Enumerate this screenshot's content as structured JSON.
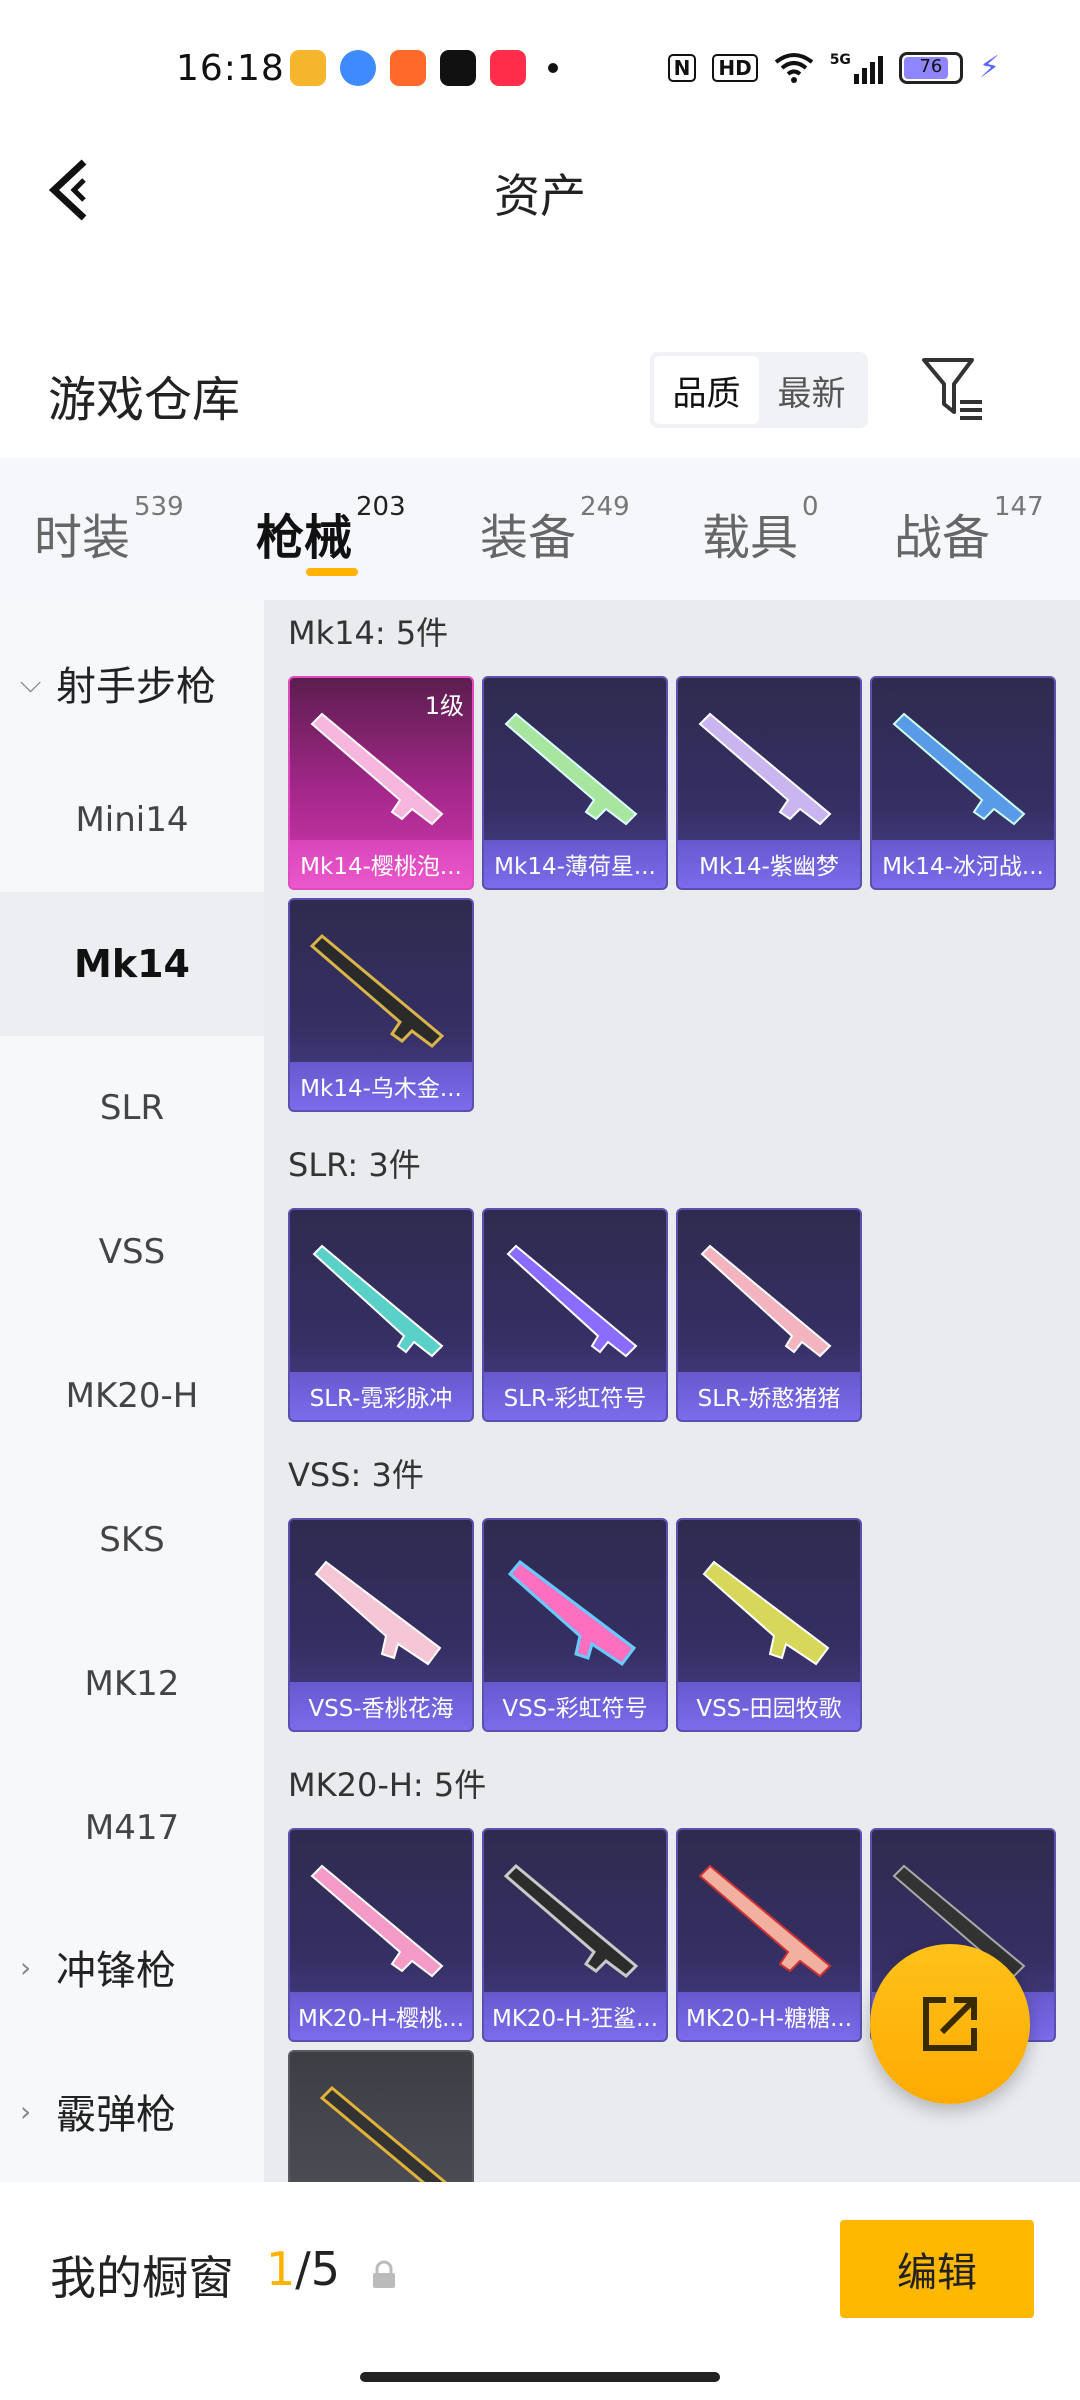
{
  "status": {
    "time": "16:18",
    "battery": "76",
    "hd": "HD",
    "net": "5G"
  },
  "header": {
    "title": "资产"
  },
  "section": {
    "title": "游戏仓库",
    "sort_quality": "品质",
    "sort_newest": "最新"
  },
  "tabs": [
    {
      "label": "时装",
      "count": "539"
    },
    {
      "label": "枪械",
      "count": "203"
    },
    {
      "label": "装备",
      "count": "249"
    },
    {
      "label": "载具",
      "count": "0"
    },
    {
      "label": "战备",
      "count": "147"
    }
  ],
  "sidebar": {
    "group_marksman": "射手步枪",
    "items": [
      "Mini14",
      "Mk14",
      "SLR",
      "VSS",
      "MK20-H",
      "SKS",
      "MK12",
      "M417"
    ],
    "group_smg": "冲锋枪",
    "group_shotgun": "霰弹枪"
  },
  "groups": [
    {
      "title": "Mk14: 5件",
      "cards": [
        "Mk14-樱桃泡...",
        "Mk14-薄荷星...",
        "Mk14-紫幽梦",
        "Mk14-冰河战...",
        "Mk14-乌木金..."
      ]
    },
    {
      "title": "SLR: 3件",
      "cards": [
        "SLR-霓彩脉冲",
        "SLR-彩虹符号",
        "SLR-娇憨猪猪"
      ]
    },
    {
      "title": "VSS: 3件",
      "cards": [
        "VSS-香桃花海",
        "VSS-彩虹符号",
        "VSS-田园牧歌"
      ]
    },
    {
      "title": "MK20-H: 5件",
      "cards": [
        "MK20-H-樱桃...",
        "MK20-H-狂鲨...",
        "MK20-H-糖糖...",
        "..."
      ]
    }
  ],
  "first_card_level": "1级",
  "bottom": {
    "showcase_label": "我的橱窗",
    "showcase_current": "1",
    "showcase_total": "/5",
    "edit_label": "编辑"
  },
  "colors": {
    "accent": "#ffb300",
    "card_purple": "#352f63",
    "card_pink": "#d23bb1"
  }
}
